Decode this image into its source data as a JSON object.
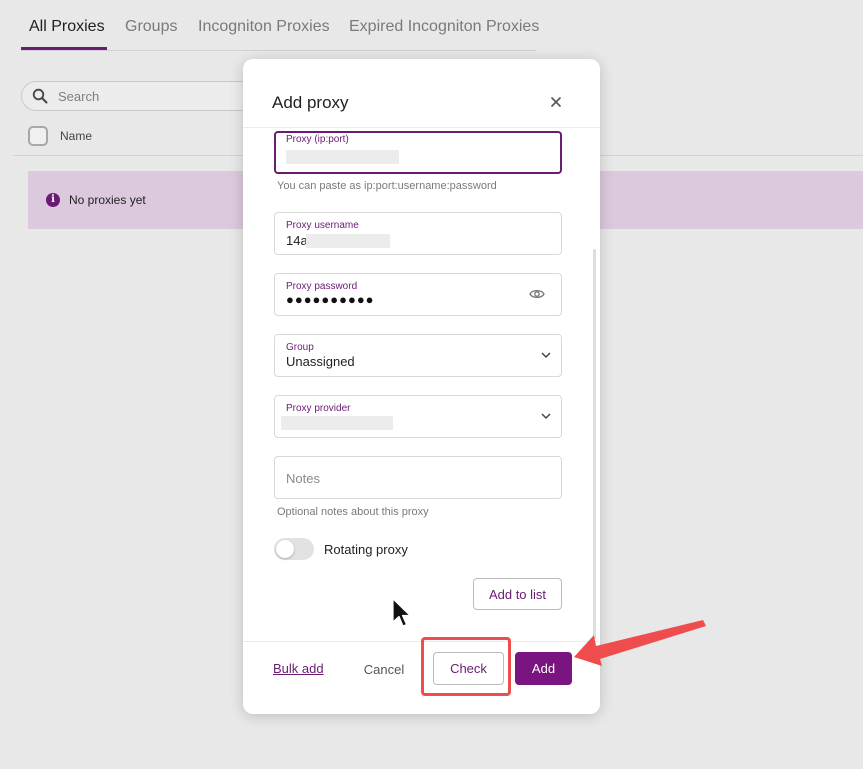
{
  "tabs": [
    {
      "label": "All Proxies"
    },
    {
      "label": "Groups"
    },
    {
      "label": "Incogniton Proxies"
    },
    {
      "label": "Expired Incogniton Proxies"
    }
  ],
  "search": {
    "placeholder": "Search"
  },
  "table": {
    "name_header": "Name"
  },
  "empty_state": {
    "message": "No proxies yet"
  },
  "modal": {
    "title": "Add proxy",
    "proxy_field": {
      "label": "Proxy (ip:port)",
      "value": "",
      "helper": "You can paste as ip:port:username:password"
    },
    "username_field": {
      "label": "Proxy username",
      "value": "14a"
    },
    "password_field": {
      "label": "Proxy password",
      "value": "●●●●●●●●●●"
    },
    "group_field": {
      "label": "Group",
      "value": "Unassigned"
    },
    "provider_field": {
      "label": "Proxy provider",
      "value": ""
    },
    "notes_field": {
      "placeholder": "Notes",
      "helper": "Optional notes about this proxy"
    },
    "rotating": {
      "label": "Rotating proxy",
      "enabled": false
    },
    "add_to_list_label": "Add to list",
    "bulk_add_label": "Bulk add",
    "cancel_label": "Cancel",
    "check_label": "Check",
    "add_label": "Add"
  },
  "colors": {
    "accent": "#6a1b74",
    "primary_button": "#7a1480",
    "annotation": "#ef4d4d",
    "empty_banner": "#dcc9dd"
  }
}
